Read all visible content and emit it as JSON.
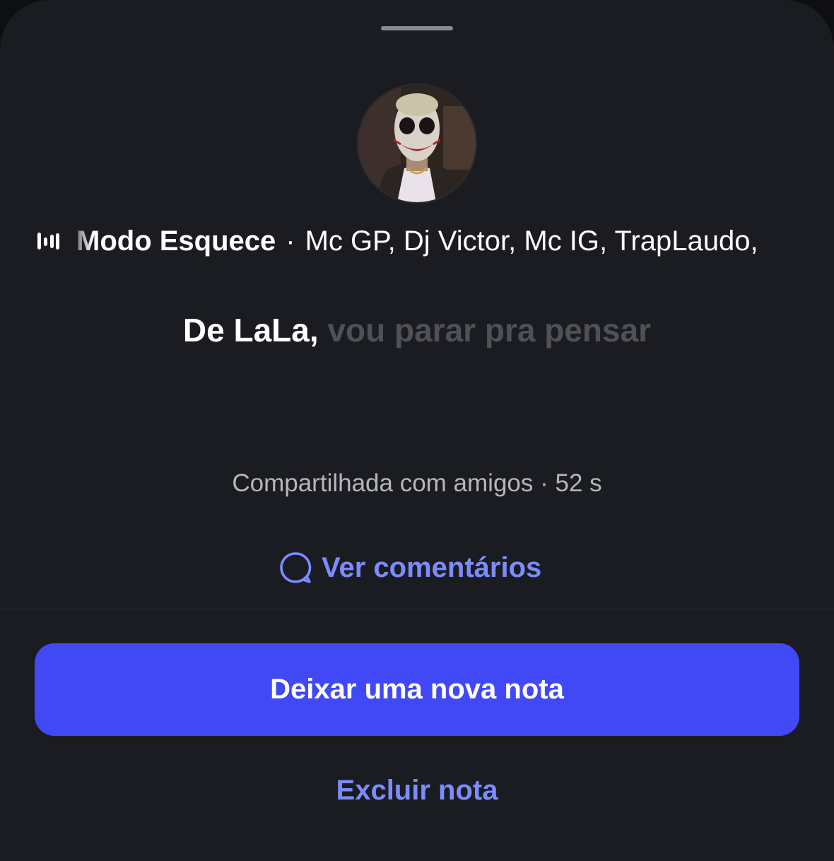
{
  "note": {
    "music": {
      "icon": "audio-wave-icon",
      "song_title": "Modo Esquece",
      "separator": "·",
      "artists": "Mc GP, Dj Victor, Mc IG, TrapLaudo,"
    },
    "lyrics": {
      "active": "De LaLa,",
      "upcoming": "vou parar pra pensar"
    },
    "meta": "Compartilhada com amigos · 52 s"
  },
  "actions": {
    "comments_icon": "comment-bubble-icon",
    "comments_label": "Ver comentários",
    "primary_label": "Deixar uma nova nota",
    "delete_label": "Excluir nota"
  },
  "colors": {
    "sheet_background": "#1b1c21",
    "accent": "#4049f5",
    "link": "#7c8cff",
    "muted_text": "#b5b6bb",
    "dim_lyric": "#4f5157"
  }
}
